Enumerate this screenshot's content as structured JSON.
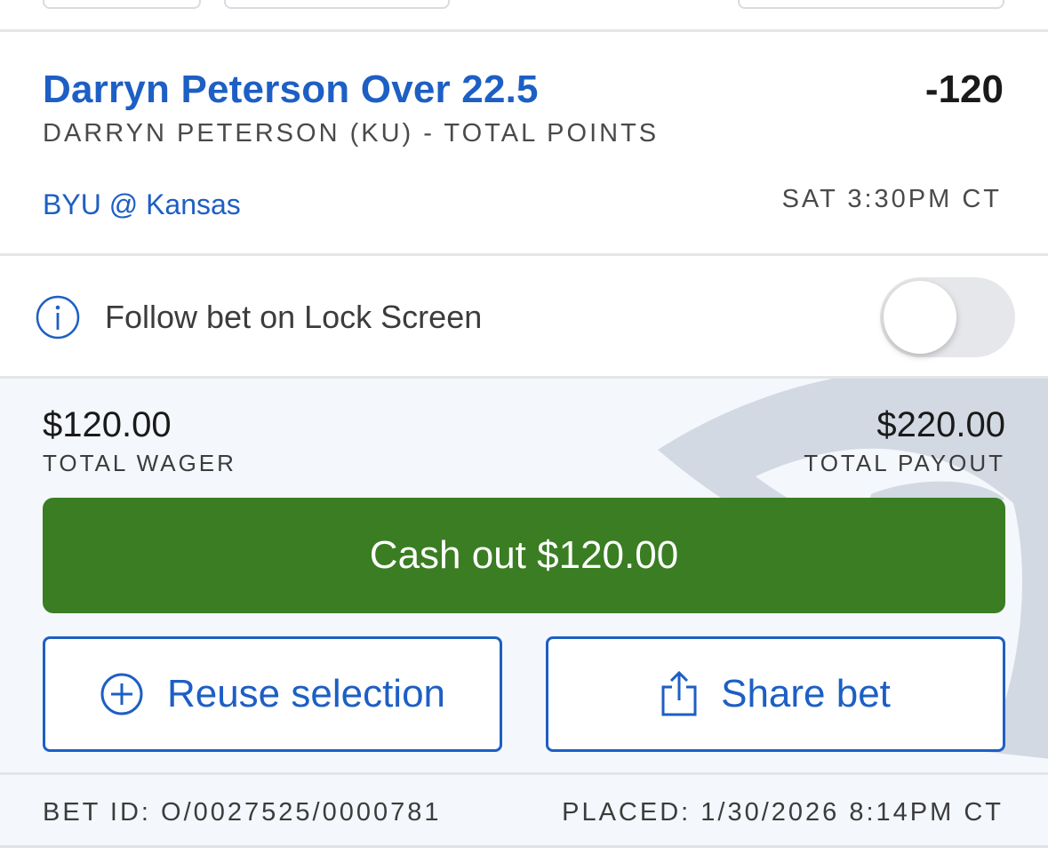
{
  "selection": {
    "title": "Darryn Peterson Over 22.5",
    "odds": "-120",
    "market": "DARRYN PETERSON (KU) - TOTAL POINTS",
    "matchup": "BYU @ Kansas",
    "game_time": "SAT 3:30PM CT"
  },
  "follow": {
    "label": "Follow bet on Lock Screen",
    "toggle_on": false
  },
  "wager": {
    "total_wager": "$120.00",
    "total_wager_label": "TOTAL WAGER",
    "total_payout": "$220.00",
    "total_payout_label": "TOTAL PAYOUT"
  },
  "actions": {
    "cashout_label": "Cash out $120.00",
    "reuse_label": "Reuse selection",
    "share_label": "Share bet"
  },
  "footer": {
    "bet_id": "BET ID: O/0027525/0000781",
    "placed": "PLACED: 1/30/2026 8:14PM CT"
  },
  "colors": {
    "link_blue": "#1d5fc4",
    "cashout_green": "#3a7d22",
    "section_bg": "#f4f7fb"
  },
  "icons": {
    "info": "info-icon",
    "reuse": "plus-circle-icon",
    "share": "share-icon"
  }
}
